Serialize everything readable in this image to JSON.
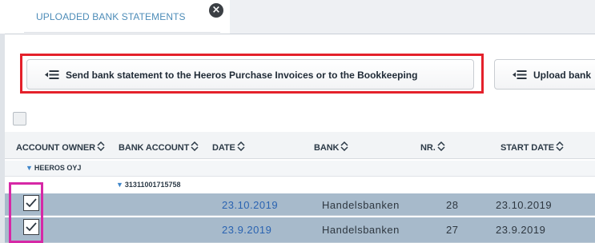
{
  "tab": {
    "label": "UPLOADED BANK STATEMENTS",
    "close_glyph": "×"
  },
  "toolbar": {
    "send_label": "Send bank statement to the Heeros Purchase Invoices or to the Bookkeeping",
    "send_icon": "list-arrow-icon",
    "upload_label": "Upload bank",
    "upload_icon": "list-arrow-icon"
  },
  "table": {
    "columns": [
      "ACCOUNT OWNER",
      "BANK ACCOUNT",
      "DATE",
      "BANK",
      "NR.",
      "START DATE"
    ],
    "groups": {
      "owner": "HEEROS OYJ",
      "account": "31311001715758"
    },
    "rows": [
      {
        "date": "23.10.2019",
        "bank": "Handelsbanken",
        "nr": "28",
        "start_date": "23.10.2019",
        "checked": true
      },
      {
        "date": "23.9.2019",
        "bank": "Handelsbanken",
        "nr": "27",
        "start_date": "23.9.2019",
        "checked": true
      }
    ]
  },
  "colors": {
    "tab_text": "#4d8cb8",
    "selected_row": "#a7bacb",
    "date_link": "#2a63b1",
    "highlight_red": "#e4212b",
    "highlight_pink": "#d628a6"
  }
}
